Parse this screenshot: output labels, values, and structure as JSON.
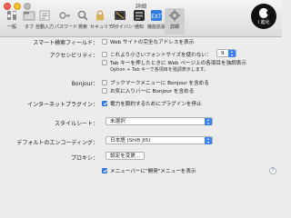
{
  "window": {
    "title": "詳細"
  },
  "toolbar": [
    {
      "label": "一般",
      "icon": "switch-icon"
    },
    {
      "label": "タブ",
      "icon": "tabs-icon"
    },
    {
      "label": "自動入力",
      "icon": "autofill-icon"
    },
    {
      "label": "パスワード",
      "icon": "key-icon"
    },
    {
      "label": "検索",
      "icon": "search-icon"
    },
    {
      "label": "セキュリティ",
      "icon": "lock-icon"
    },
    {
      "label": "プライバシー",
      "icon": "privacy-icon"
    },
    {
      "label": "通知",
      "icon": "notifications-icon"
    },
    {
      "label": "機能拡張",
      "icon": "extensions-icon"
    },
    {
      "label": "詳細",
      "icon": "gear-icon"
    }
  ],
  "badge": {
    "text": "I 進化"
  },
  "settings": {
    "smart_search": {
      "label": "スマート検索フィールド：",
      "option": "Web サイトの完全なアドレスを表示"
    },
    "accessibility": {
      "label": "アクセシビリティ：",
      "option1": "これより小さいフォントサイズを使わない：",
      "font_size": "9",
      "option2": "Tab キーを押したときに Web ページ上の各項目を強調表示",
      "note": "Option + Tab キーで各項目を強調表示します。"
    },
    "bonjour": {
      "label": "Bonjour：",
      "option1": "ブックマークメニューに Bonjour を含める",
      "option2": "お気に入りバーに Bonjour を含める"
    },
    "plugins": {
      "label": "インターネットプラグイン：",
      "option": "電力を節約するためにプラグインを停止"
    },
    "stylesheet": {
      "label": "スタイルシート：",
      "value": "未選択"
    },
    "encoding": {
      "label": "デフォルトのエンコーディング：",
      "value": "日本語 (Shift JIS)"
    },
    "proxy": {
      "label": "プロキシ：",
      "button": "設定を変更..."
    },
    "develop": {
      "option": "メニューバーに\"開発\"メニューを表示"
    },
    "help": "?"
  }
}
